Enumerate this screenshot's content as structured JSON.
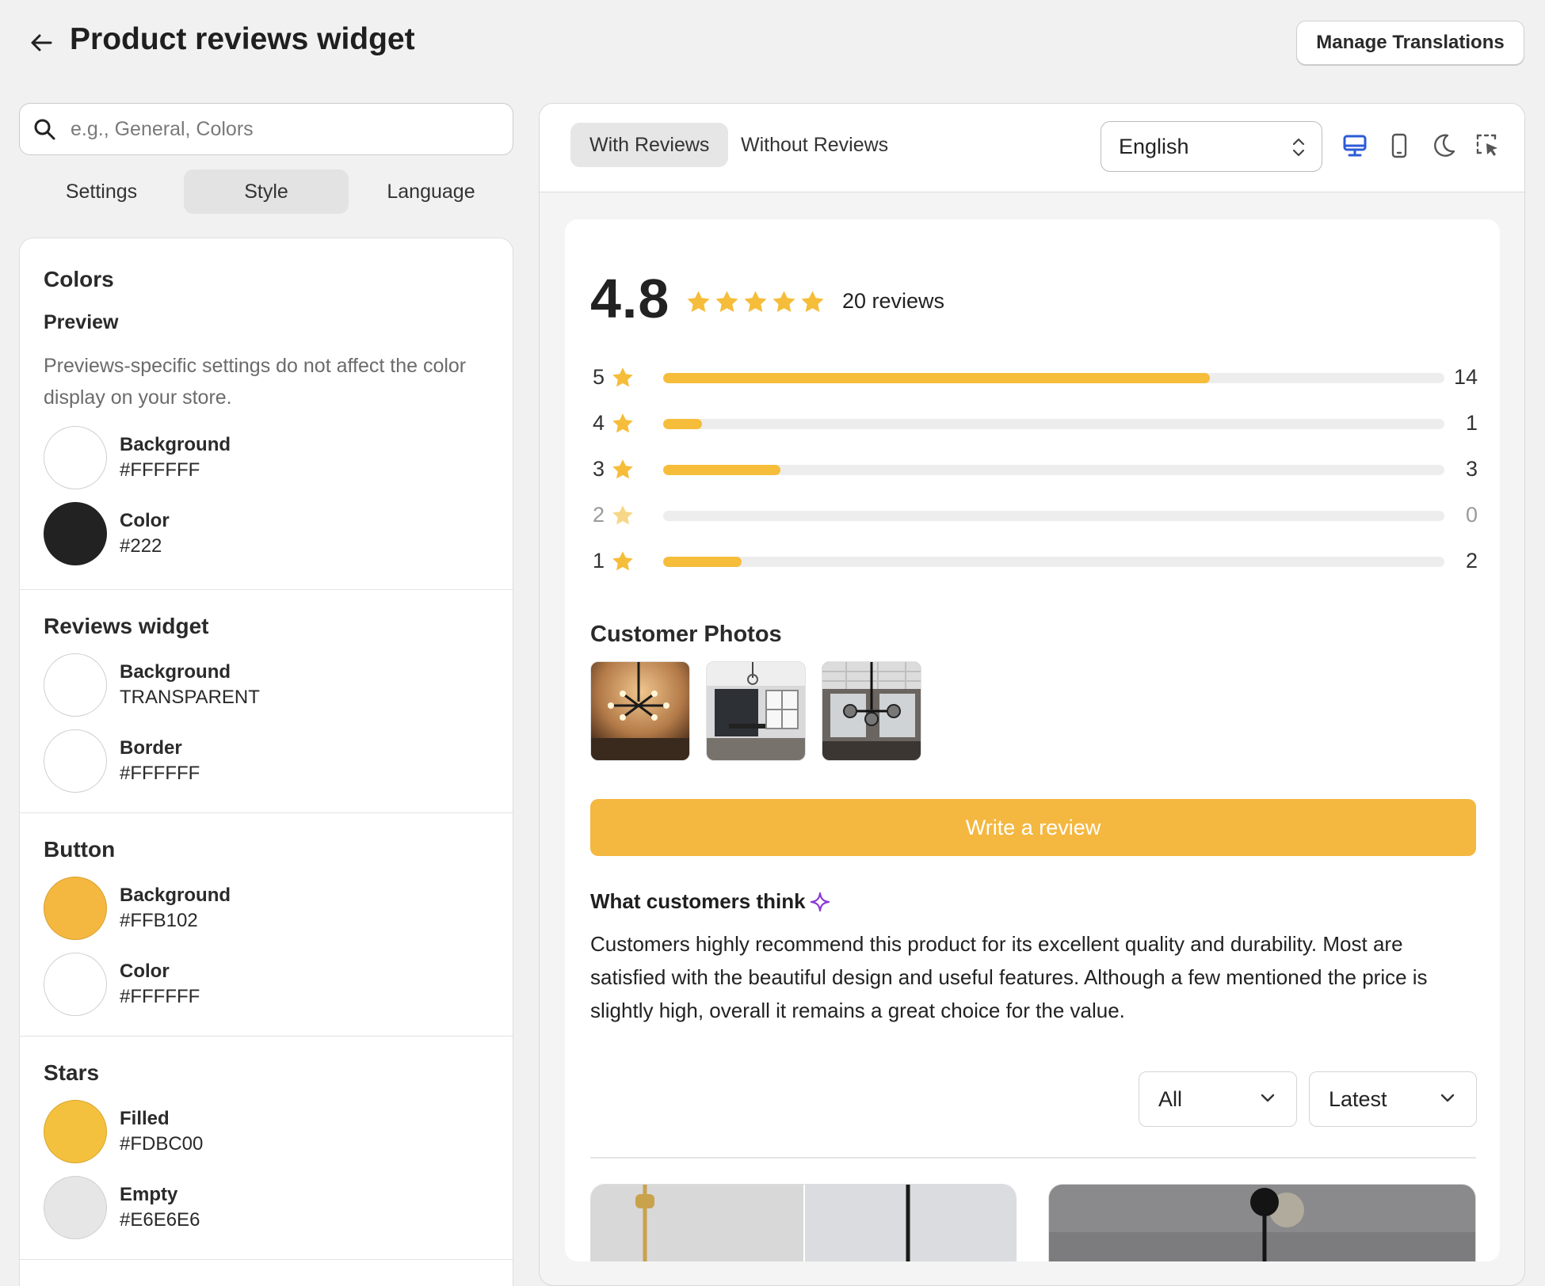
{
  "header": {
    "title": "Product reviews widget",
    "manage_translations": "Manage Translations"
  },
  "left": {
    "search_placeholder": "e.g., General, Colors",
    "tabs": [
      "Settings",
      "Style",
      "Language"
    ],
    "active_tab": "Style",
    "colors": {
      "title": "Colors",
      "preview_title": "Preview",
      "preview_desc": "Previews-specific settings do not affect the color display on your store.",
      "preview_items": [
        {
          "label": "Background",
          "value": "#FFFFFF",
          "swatch": "#FFFFFF"
        },
        {
          "label": "Color",
          "value": "#222",
          "swatch": "#222222"
        }
      ]
    },
    "reviews_widget": {
      "title": "Reviews widget",
      "items": [
        {
          "label": "Background",
          "value": "TRANSPARENT",
          "swatch": "#FFFFFF"
        },
        {
          "label": "Border",
          "value": "#FFFFFF",
          "swatch": "#FFFFFF"
        }
      ]
    },
    "button": {
      "title": "Button",
      "items": [
        {
          "label": "Background",
          "value": "#FFB102",
          "swatch": "#F4B740"
        },
        {
          "label": "Color",
          "value": "#FFFFFF",
          "swatch": "#FFFFFF"
        }
      ]
    },
    "stars": {
      "title": "Stars",
      "items": [
        {
          "label": "Filled",
          "value": "#FDBC00",
          "swatch": "#F4C13E"
        },
        {
          "label": "Empty",
          "value": "#E6E6E6",
          "swatch": "#E6E6E6"
        }
      ]
    }
  },
  "preview": {
    "tabs": [
      "With Reviews",
      "Without Reviews"
    ],
    "active_tab": "With Reviews",
    "language": "English",
    "icons": [
      "desktop-icon",
      "mobile-icon",
      "dark-mode-icon",
      "element-picker-icon"
    ],
    "accent_color": "#2C5BD8",
    "rating": "4.8",
    "rating_value": 4.8,
    "review_count": "20 reviews",
    "distribution": [
      {
        "stars": "5",
        "count": "14",
        "fraction": 0.7
      },
      {
        "stars": "4",
        "count": "1",
        "fraction": 0.05
      },
      {
        "stars": "3",
        "count": "3",
        "fraction": 0.15
      },
      {
        "stars": "2",
        "count": "0",
        "fraction": 0
      },
      {
        "stars": "1",
        "count": "2",
        "fraction": 0.1
      }
    ],
    "photos_title": "Customer Photos",
    "write_review": "Write a review",
    "think_title": "What customers think",
    "think_body": "Customers highly recommend this product for its excellent quality and durability. Most are satisfied with the beautiful design and useful features. Although a few mentioned the price is slightly high, overall it remains a great choice for the value.",
    "filter_all": "All",
    "sort_latest": "Latest",
    "star_color": "#F5BD3A",
    "button_color": "#F4B740"
  }
}
